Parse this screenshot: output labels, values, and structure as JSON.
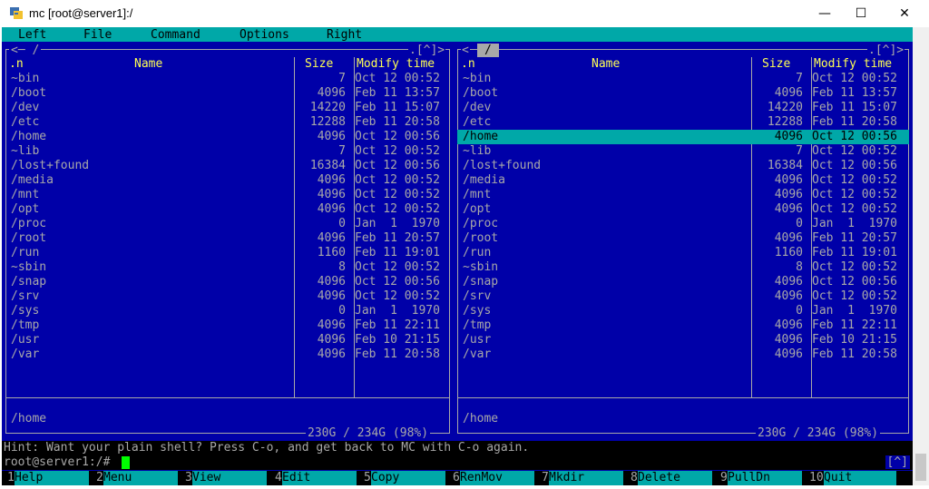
{
  "window": {
    "title": "mc [root@server1]:/",
    "minimize": "—",
    "maximize": "☐",
    "close": "✕"
  },
  "menu": [
    "Left",
    "File",
    "Command",
    "Options",
    "Right"
  ],
  "left_panel": {
    "path": "<─ /",
    "corner": ".[^]>",
    "headers": {
      "name_col": ".n",
      "name": "Name",
      "size": "Size",
      "modify": "Modify time"
    },
    "rows": [
      {
        "name": "~bin",
        "size": "7",
        "date": "Oct 12 00:52"
      },
      {
        "name": "/boot",
        "size": "4096",
        "date": "Feb 11 13:57"
      },
      {
        "name": "/dev",
        "size": "14220",
        "date": "Feb 11 15:07"
      },
      {
        "name": "/etc",
        "size": "12288",
        "date": "Feb 11 20:58"
      },
      {
        "name": "/home",
        "size": "4096",
        "date": "Oct 12 00:56"
      },
      {
        "name": "~lib",
        "size": "7",
        "date": "Oct 12 00:52"
      },
      {
        "name": "/lost+found",
        "size": "16384",
        "date": "Oct 12 00:56"
      },
      {
        "name": "/media",
        "size": "4096",
        "date": "Oct 12 00:52"
      },
      {
        "name": "/mnt",
        "size": "4096",
        "date": "Oct 12 00:52"
      },
      {
        "name": "/opt",
        "size": "4096",
        "date": "Oct 12 00:52"
      },
      {
        "name": "/proc",
        "size": "0",
        "date": "Jan  1  1970"
      },
      {
        "name": "/root",
        "size": "4096",
        "date": "Feb 11 20:57"
      },
      {
        "name": "/run",
        "size": "1160",
        "date": "Feb 11 19:01"
      },
      {
        "name": "~sbin",
        "size": "8",
        "date": "Oct 12 00:52"
      },
      {
        "name": "/snap",
        "size": "4096",
        "date": "Oct 12 00:56"
      },
      {
        "name": "/srv",
        "size": "4096",
        "date": "Oct 12 00:52"
      },
      {
        "name": "/sys",
        "size": "0",
        "date": "Jan  1  1970"
      },
      {
        "name": "/tmp",
        "size": "4096",
        "date": "Feb 11 22:11"
      },
      {
        "name": "/usr",
        "size": "4096",
        "date": "Feb 10 21:15"
      },
      {
        "name": "/var",
        "size": "4096",
        "date": "Feb 11 20:58"
      }
    ],
    "mini_status": "/home",
    "usage": "230G / 234G (98%)"
  },
  "right_panel": {
    "path": "/",
    "path_prefix": "<",
    "corner": ".[^]>",
    "headers": {
      "name_col": ".n",
      "name": "Name",
      "size": "Size",
      "modify": "Modify time"
    },
    "selected_index": 4,
    "rows": [
      {
        "name": "~bin",
        "size": "7",
        "date": "Oct 12 00:52"
      },
      {
        "name": "/boot",
        "size": "4096",
        "date": "Feb 11 13:57"
      },
      {
        "name": "/dev",
        "size": "14220",
        "date": "Feb 11 15:07"
      },
      {
        "name": "/etc",
        "size": "12288",
        "date": "Feb 11 20:58"
      },
      {
        "name": "/home",
        "size": "4096",
        "date": "Oct 12 00:56"
      },
      {
        "name": "~lib",
        "size": "7",
        "date": "Oct 12 00:52"
      },
      {
        "name": "/lost+found",
        "size": "16384",
        "date": "Oct 12 00:56"
      },
      {
        "name": "/media",
        "size": "4096",
        "date": "Oct 12 00:52"
      },
      {
        "name": "/mnt",
        "size": "4096",
        "date": "Oct 12 00:52"
      },
      {
        "name": "/opt",
        "size": "4096",
        "date": "Oct 12 00:52"
      },
      {
        "name": "/proc",
        "size": "0",
        "date": "Jan  1  1970"
      },
      {
        "name": "/root",
        "size": "4096",
        "date": "Feb 11 20:57"
      },
      {
        "name": "/run",
        "size": "1160",
        "date": "Feb 11 19:01"
      },
      {
        "name": "~sbin",
        "size": "8",
        "date": "Oct 12 00:52"
      },
      {
        "name": "/snap",
        "size": "4096",
        "date": "Oct 12 00:56"
      },
      {
        "name": "/srv",
        "size": "4096",
        "date": "Oct 12 00:52"
      },
      {
        "name": "/sys",
        "size": "0",
        "date": "Jan  1  1970"
      },
      {
        "name": "/tmp",
        "size": "4096",
        "date": "Feb 11 22:11"
      },
      {
        "name": "/usr",
        "size": "4096",
        "date": "Feb 10 21:15"
      },
      {
        "name": "/var",
        "size": "4096",
        "date": "Feb 11 20:58"
      }
    ],
    "mini_status": "/home",
    "usage": "230G / 234G (98%)"
  },
  "hint": "Hint: Want your plain shell? Press C-o, and get back to MC with C-o again.",
  "prompt": "root@server1:/#",
  "indicator": "[^]",
  "fkeys": [
    {
      "num": "1",
      "label": "Help"
    },
    {
      "num": "2",
      "label": "Menu"
    },
    {
      "num": "3",
      "label": "View"
    },
    {
      "num": "4",
      "label": "Edit"
    },
    {
      "num": "5",
      "label": "Copy"
    },
    {
      "num": "6",
      "label": "RenMov"
    },
    {
      "num": "7",
      "label": "Mkdir"
    },
    {
      "num": "8",
      "label": "Delete"
    },
    {
      "num": "9",
      "label": "PullDn"
    },
    {
      "num": "10",
      "label": "Quit"
    }
  ],
  "colors": {
    "terminal_bg": "#0000a8",
    "menu_bg": "#00a8a8",
    "text": "#a8a8a8",
    "header": "#ffff54",
    "cursor": "#00ff00"
  }
}
